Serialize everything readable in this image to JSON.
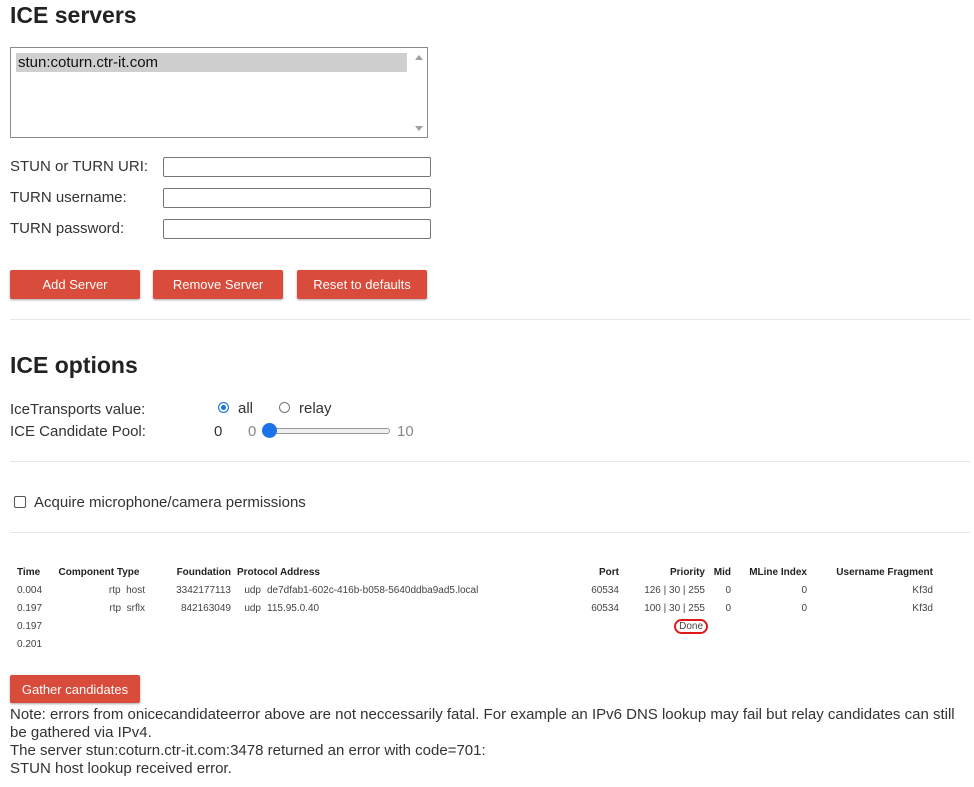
{
  "ice_servers": {
    "title": "ICE servers",
    "server_list": [
      "stun:coturn.ctr-it.com"
    ],
    "stun_uri_label": "STUN or TURN URI:",
    "stun_uri_value": "",
    "username_label": "TURN username:",
    "username_value": "",
    "password_label": "TURN password:",
    "password_value": "",
    "add_button": "Add Server",
    "remove_button": "Remove Server",
    "reset_button": "Reset to defaults"
  },
  "ice_options": {
    "title": "ICE options",
    "transports_label": "IceTransports value:",
    "transport_all": "all",
    "transport_relay": "relay",
    "transport_selected": "all",
    "pool_label": "ICE Candidate Pool:",
    "pool_value": "0",
    "pool_min": "0",
    "pool_max": "10",
    "pool_fraction": 0.0
  },
  "permissions": {
    "label": "Acquire microphone/camera permissions",
    "checked": false
  },
  "candidates": {
    "headers": [
      "Time",
      "Component Type",
      "Foundation",
      "Protocol Address",
      "Port",
      "Priority",
      "Mid",
      "MLine Index",
      "Username Fragment"
    ],
    "rows": [
      {
        "time": "0.004",
        "component": "rtp",
        "type": "host",
        "foundation": "3342177113",
        "protocol": "udp",
        "address": "de7dfab1-602c-416b-b058-5640ddba9ad5.local",
        "port": "60534",
        "priority": "126 | 30 | 255",
        "mid": "0",
        "mline": "0",
        "ufrag": "Kf3d"
      },
      {
        "time": "0.197",
        "component": "rtp",
        "type": "srflx",
        "foundation": "842163049",
        "protocol": "udp",
        "address": "115.95.0.40",
        "port": "60534",
        "priority": "100 | 30 | 255",
        "mid": "0",
        "mline": "0",
        "ufrag": "Kf3d"
      },
      {
        "time": "0.197",
        "component": "",
        "type": "",
        "foundation": "",
        "protocol": "",
        "address": "",
        "port": "",
        "priority": "Done",
        "mid": "",
        "mline": "",
        "ufrag": ""
      },
      {
        "time": "0.201",
        "component": "",
        "type": "",
        "foundation": "",
        "protocol": "",
        "address": "",
        "port": "",
        "priority": "",
        "mid": "",
        "mline": "",
        "ufrag": ""
      }
    ],
    "gather_button": "Gather candidates"
  },
  "notes": {
    "line1": "Note: errors from onicecandidateerror above are not neccessarily fatal. For example an IPv6 DNS lookup may fail but relay candidates can still be gathered via IPv4.",
    "line2": "The server stun:coturn.ctr-it.com:3478 returned an error with code=701:",
    "line3": "STUN host lookup received error."
  },
  "colors": {
    "button_red": "#d94b3a",
    "accent_blue": "#1a73e8",
    "annotation_red": "#e01818"
  }
}
